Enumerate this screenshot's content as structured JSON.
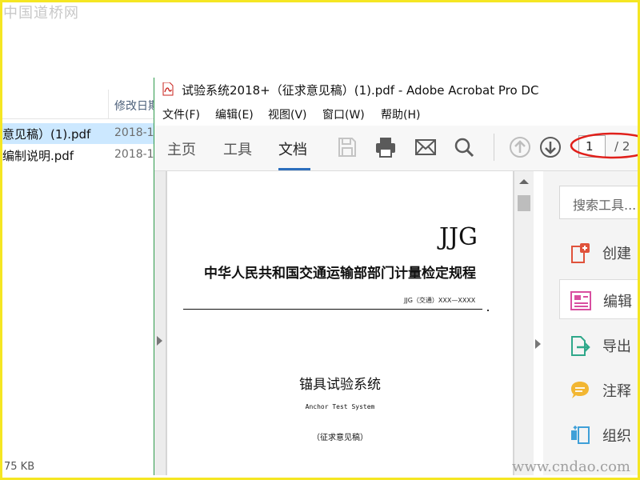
{
  "watermark": {
    "top_left": "中国道桥网",
    "bottom_right": "www.cndao.com"
  },
  "explorer": {
    "column_date": "修改日期",
    "files": [
      {
        "name": "意见稿）(1).pdf",
        "date": "2018-1",
        "selected": true
      },
      {
        "name": "编制说明.pdf",
        "date": "2018-1",
        "selected": false
      }
    ],
    "size_text": "75 KB"
  },
  "acrobat": {
    "title": "试验系统2018+（征求意见稿）(1).pdf - Adobe Acrobat Pro DC",
    "menu": [
      "文件(F)",
      "编辑(E)",
      "视图(V)",
      "窗口(W)",
      "帮助(H)"
    ],
    "tabs": [
      "主页",
      "工具",
      "文档"
    ],
    "active_tab": "文档",
    "toolbar_icons": [
      "save-icon",
      "print-icon",
      "email-icon",
      "search-icon",
      "page-up-icon",
      "page-down-icon"
    ],
    "page_current": "1",
    "page_total": "/ 2",
    "accent_color": "#2d6fbd",
    "annotation_color": "#e0201b"
  },
  "document": {
    "code_mark": "JJG",
    "title": "中华人民共和国交通运输部部门计量检定规程",
    "code": "JJG（交通）XXX—XXXX",
    "name": "锚具试验系统",
    "name_en": "Anchor Test System",
    "draft": "（征求意见稿）"
  },
  "tools_pane": {
    "search_placeholder": "搜索工具...",
    "tools": [
      {
        "label": "创建",
        "icon": "create-pdf-icon",
        "color": "#e0523b",
        "active": false
      },
      {
        "label": "编辑",
        "icon": "edit-pdf-icon",
        "color": "#d94fa0",
        "active": true
      },
      {
        "label": "导出",
        "icon": "export-pdf-icon",
        "color": "#2fa88a",
        "active": false
      },
      {
        "label": "注释",
        "icon": "comment-icon",
        "color": "#f2b632",
        "active": false
      },
      {
        "label": "组织",
        "icon": "organize-pages-icon",
        "color": "#3fa0d8",
        "active": false
      }
    ]
  }
}
